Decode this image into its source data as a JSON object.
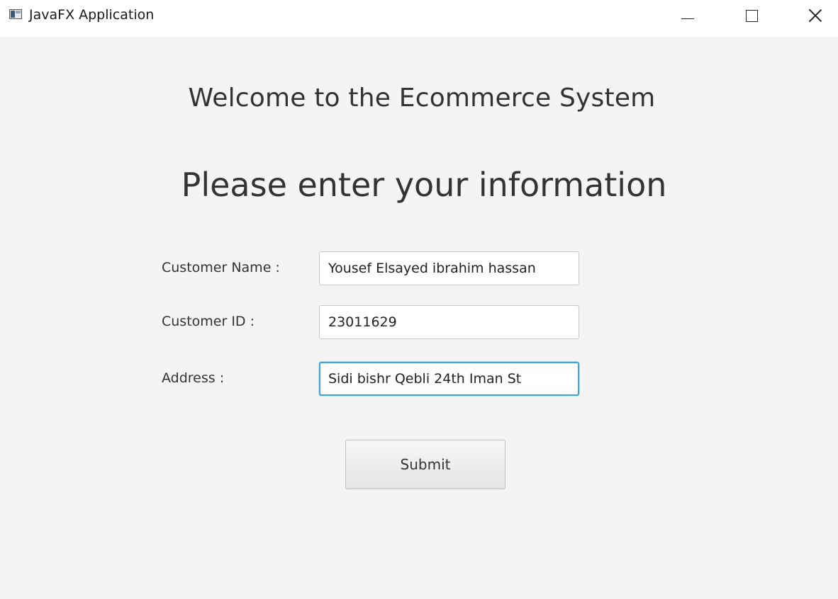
{
  "window": {
    "title": "JavaFX Application",
    "icon": "javafx-window-icon"
  },
  "controls": {
    "minimize": "minimize-icon",
    "maximize": "maximize-icon",
    "close": "close-icon"
  },
  "header": {
    "welcome": "Welcome to the Ecommerce System",
    "instruction": "Please enter your information"
  },
  "form": {
    "name_label": "Customer Name :",
    "name_value": "Yousef Elsayed ibrahim hassan",
    "id_label": "Customer ID :",
    "id_value": "23011629",
    "address_label": "Address :",
    "address_value": "Sidi bishr Qebli 24th Iman St",
    "submit_label": "Submit"
  },
  "colors": {
    "background": "#f4f4f4",
    "focus_border": "#3ca6d9"
  }
}
